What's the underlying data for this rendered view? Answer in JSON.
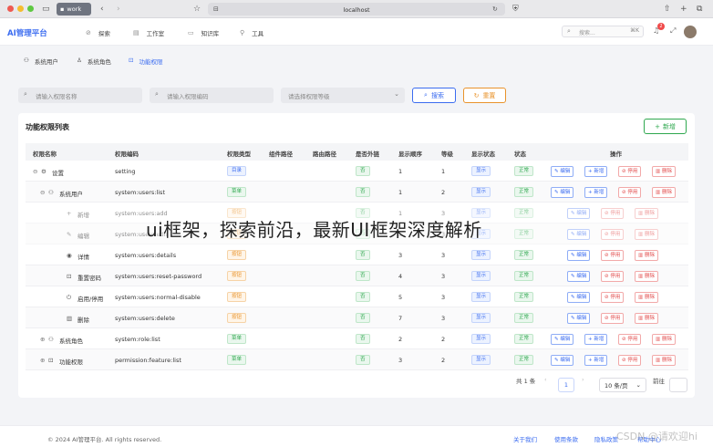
{
  "browser": {
    "tab_label": "work",
    "url": "localhost",
    "traffic_colors": [
      "#ee5a52",
      "#f5bd2f",
      "#5ec841"
    ]
  },
  "app": {
    "brand": "AI管理平台",
    "nav": [
      {
        "label": "探索",
        "icon": "compass-icon"
      },
      {
        "label": "工作室",
        "icon": "grid-icon"
      },
      {
        "label": "知识库",
        "icon": "book-icon"
      },
      {
        "label": "工具",
        "icon": "wrench-icon"
      }
    ],
    "search_placeholder": "搜索...",
    "search_shortcut": "⌘K",
    "notification_count": "2"
  },
  "breadcrumbs": [
    {
      "label": "系统用户",
      "icon": "users-icon"
    },
    {
      "label": "系统角色",
      "icon": "user-icon"
    },
    {
      "label": "功能权限",
      "icon": "lock-icon",
      "active": true
    }
  ],
  "filters": {
    "name_placeholder": "请输入权限名称",
    "code_placeholder": "请输入权限编码",
    "level_placeholder": "请选择权限等级",
    "search_label": "搜索",
    "reset_label": "重置"
  },
  "table": {
    "title": "功能权限列表",
    "add_label": "新增",
    "columns": [
      "权限名称",
      "权限编码",
      "权限类型",
      "组件路径",
      "路由路径",
      "是否外链",
      "显示顺序",
      "等级",
      "显示状态",
      "状态",
      "操作"
    ],
    "rows": [
      {
        "name": "设置",
        "toggle": "⊖",
        "icon": "⚙",
        "code": "setting",
        "type": "目录",
        "type_class": "dir",
        "external": "否",
        "order": "1",
        "level": "1",
        "visible": "显示",
        "status": "正常",
        "ops": [
          "编辑",
          "新增",
          "停用",
          "删除"
        ]
      },
      {
        "name": "系统用户",
        "toggle": "⊖",
        "icon": "⚇",
        "code": "system:users:list",
        "type": "菜单",
        "type_class": "menu",
        "external": "否",
        "order": "1",
        "level": "2",
        "visible": "显示",
        "status": "正常",
        "ops": [
          "编辑",
          "新增",
          "停用",
          "删除"
        ]
      },
      {
        "name": "新增",
        "toggle": "",
        "icon": "+",
        "code": "system:users:add",
        "type": "按钮",
        "type_class": "btnt",
        "external": "否",
        "order": "1",
        "level": "3",
        "visible": "显示",
        "status": "正常",
        "ops": [
          "编辑",
          "停用",
          "删除"
        ],
        "faded": true
      },
      {
        "name": "编辑",
        "toggle": "",
        "icon": "✎",
        "code": "system:users:edit",
        "type": "按钮",
        "type_class": "btnt",
        "external": "否",
        "order": "2",
        "level": "3",
        "visible": "显示",
        "status": "正常",
        "ops": [
          "编辑",
          "停用",
          "删除"
        ],
        "faded": true
      },
      {
        "name": "详情",
        "toggle": "",
        "icon": "◉",
        "code": "system:users:details",
        "type": "按钮",
        "type_class": "btnt",
        "external": "否",
        "order": "3",
        "level": "3",
        "visible": "显示",
        "status": "正常",
        "ops": [
          "编辑",
          "停用",
          "删除"
        ]
      },
      {
        "name": "重置密码",
        "toggle": "",
        "icon": "⊡",
        "code": "system:users:reset-password",
        "type": "按钮",
        "type_class": "btnt",
        "external": "否",
        "order": "4",
        "level": "3",
        "visible": "显示",
        "status": "正常",
        "ops": [
          "编辑",
          "停用",
          "删除"
        ]
      },
      {
        "name": "启用/停用",
        "toggle": "",
        "icon": "⏻",
        "code": "system:users:normal-disable",
        "type": "按钮",
        "type_class": "btnt",
        "external": "否",
        "order": "5",
        "level": "3",
        "visible": "显示",
        "status": "正常",
        "ops": [
          "编辑",
          "停用",
          "删除"
        ]
      },
      {
        "name": "删除",
        "toggle": "",
        "icon": "▥",
        "code": "system:users:delete",
        "type": "按钮",
        "type_class": "btnt",
        "external": "否",
        "order": "7",
        "level": "3",
        "visible": "显示",
        "status": "正常",
        "ops": [
          "编辑",
          "停用",
          "删除"
        ]
      },
      {
        "name": "系统角色",
        "toggle": "⊕",
        "icon": "⚇",
        "code": "system:role:list",
        "type": "菜单",
        "type_class": "menu",
        "external": "否",
        "order": "2",
        "level": "2",
        "visible": "显示",
        "status": "正常",
        "ops": [
          "编辑",
          "新增",
          "停用",
          "删除"
        ]
      },
      {
        "name": "功能权限",
        "toggle": "⊕",
        "icon": "⊡",
        "code": "permission:feature:list",
        "type": "菜单",
        "type_class": "menu",
        "external": "否",
        "order": "3",
        "level": "2",
        "visible": "显示",
        "status": "正常",
        "ops": [
          "编辑",
          "新增",
          "停用",
          "删除"
        ]
      }
    ]
  },
  "pagination": {
    "total": "共 1 条",
    "page": "1",
    "page_size": "10 条/页",
    "goto": "前往"
  },
  "footer": {
    "copyright": "© 2024 AI管理平台. All rights reserved.",
    "links": [
      "关于我们",
      "使用条款",
      "隐私政策",
      "帮助中心"
    ]
  },
  "overlay_text": "ui框架，探索前沿，最新UI框架深度解析",
  "watermark": "CSDN @请欢迎hi"
}
